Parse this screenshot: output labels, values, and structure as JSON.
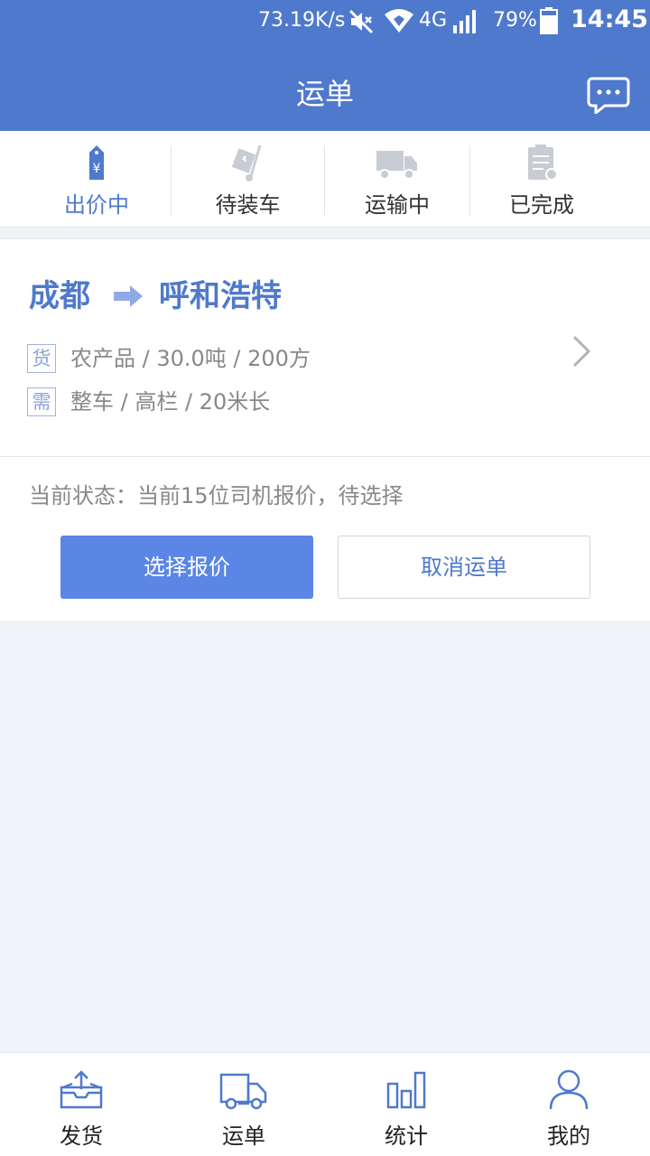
{
  "status_bar": {
    "speed": "73.19K/s",
    "network": "4G",
    "battery": "79%",
    "time": "14:45",
    "icons": [
      "mute-icon",
      "wifi-icon",
      "signal-icon",
      "battery-icon"
    ]
  },
  "header": {
    "title": "运单",
    "message_icon": "chat-bubble-icon"
  },
  "tabs": [
    {
      "label": "出价中",
      "icon": "price-tag-icon",
      "active": true
    },
    {
      "label": "待装车",
      "icon": "hand-truck-icon",
      "active": false
    },
    {
      "label": "运输中",
      "icon": "truck-icon",
      "active": false
    },
    {
      "label": "已完成",
      "icon": "clipboard-check-icon",
      "active": false
    }
  ],
  "order": {
    "from_city": "成都",
    "to_city": "呼和浩特",
    "cargo_tag": "货",
    "cargo_info": "农产品 / 30.0吨 / 200方",
    "need_tag": "需",
    "need_info": "整车 / 高栏 / 20米长",
    "status_label": "当前状态：",
    "status_text": "当前15位司机报价，待选择",
    "primary_button": "选择报价",
    "secondary_button": "取消运单"
  },
  "bottom_nav": [
    {
      "label": "发货",
      "icon": "ship-box-icon"
    },
    {
      "label": "运单",
      "icon": "truck-outline-icon"
    },
    {
      "label": "统计",
      "icon": "bar-chart-icon"
    },
    {
      "label": "我的",
      "icon": "user-icon"
    }
  ],
  "colors": {
    "brand": "#4f79cc",
    "button_primary": "#5b86e5",
    "background": "#f0f3f8"
  }
}
